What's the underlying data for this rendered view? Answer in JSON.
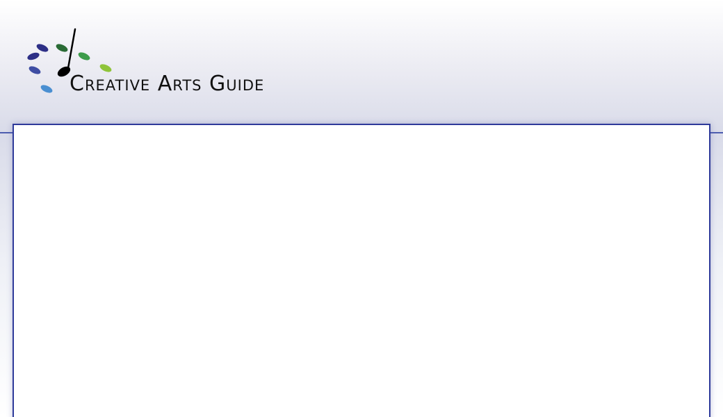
{
  "site": {
    "name": "Creative Arts Guide"
  },
  "colors": {
    "header_bottom": "#d9dbe9",
    "content_border": "#2e3a9a",
    "logo_dots": [
      "#2d2f86",
      "#3e4da3",
      "#2a6b35",
      "#3c9b4a",
      "#8fc43a",
      "#4a8fd1"
    ]
  },
  "icons": {
    "logo": "music-note-with-dots-icon"
  }
}
